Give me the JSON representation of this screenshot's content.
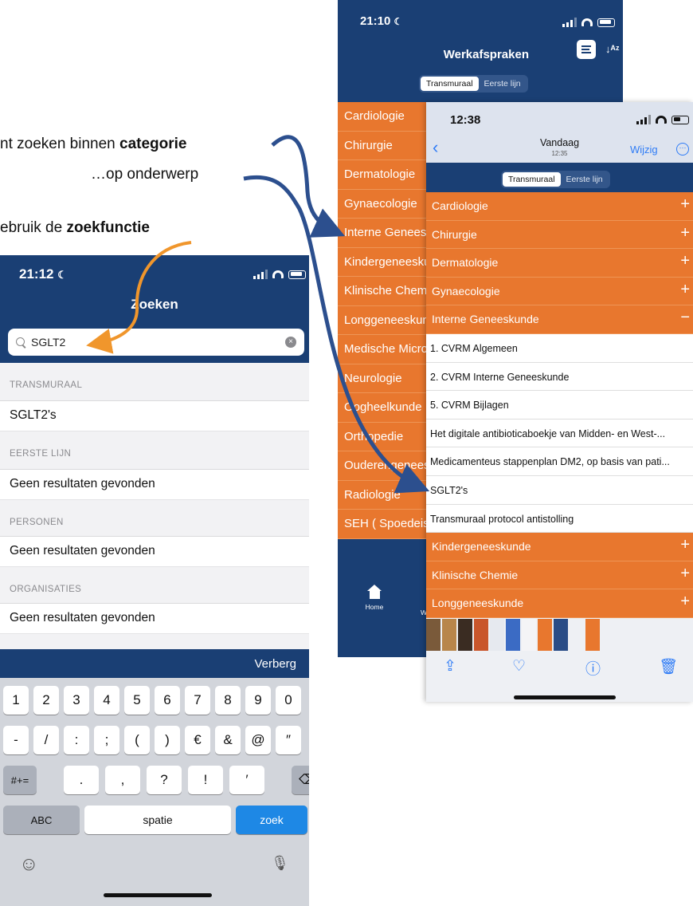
{
  "annotations": {
    "line1_prefix": "nt zoeken binnen ",
    "line1_bold": "categorie",
    "line2": "…op onderwerp",
    "line3_prefix": "ebruik de ",
    "line3_bold": "zoekfunctie"
  },
  "search_phone": {
    "time": "21:12",
    "title": "Zoeken",
    "search_value": "SGLT2",
    "clear_glyph": "×",
    "sections": [
      {
        "header": "TRANSMURAAL",
        "row": "SGLT2's"
      },
      {
        "header": "EERSTE LIJN",
        "row": "Geen resultaten gevonden"
      },
      {
        "header": "PERSONEN",
        "row": "Geen resultaten gevonden"
      },
      {
        "header": "ORGANISATIES",
        "row": "Geen resultaten gevonden"
      }
    ],
    "keyboard": {
      "hide_label": "Verberg",
      "row1": [
        "1",
        "2",
        "3",
        "4",
        "5",
        "6",
        "7",
        "8",
        "9",
        "0"
      ],
      "row2": [
        "-",
        "/",
        ":",
        ";",
        "(",
        ")",
        "€",
        "&",
        "@",
        "″"
      ],
      "row3_switch": "#+=",
      "row3": [
        ".",
        ",",
        "?",
        "!",
        "′"
      ],
      "row3_delete": "⌫",
      "abc": "ABC",
      "space": "spatie",
      "submit": "zoek",
      "emoji": "☺",
      "mic": "🎙"
    }
  },
  "werkafspraken_phone": {
    "time": "21:10",
    "title": "Werkafspraken",
    "sort_glyph": "↓ᴬᶻ",
    "segments": [
      "Transmuraal",
      "Eerste lijn"
    ],
    "categories": [
      "Cardiologie",
      "Chirurgie",
      "Dermatologie",
      "Gynaecologie",
      "Interne Geneeskunde",
      "Kindergeneeskunde",
      "Klinische Chemie",
      "Longgeneeskunde",
      "Medische Microbiologie",
      "Neurologie",
      "Oogheelkunde",
      "Orthopedie",
      "Ouderengeneeskunde",
      "Radiologie",
      "SEH ( Spoedeisende Hulp)"
    ],
    "tab_home": "Home",
    "tab_second": "W"
  },
  "photo_phone": {
    "time": "12:38",
    "title": "Vandaag",
    "subtitle": "12:35",
    "edit": "Wijzig",
    "more_glyph": "⋯",
    "back_glyph": "‹",
    "segments": [
      "Transmuraal",
      "Eerste lijn"
    ],
    "categories_top": [
      {
        "label": "Cardiologie",
        "sign": "+"
      },
      {
        "label": "Chirurgie",
        "sign": "+"
      },
      {
        "label": "Dermatologie",
        "sign": "+"
      },
      {
        "label": "Gynaecologie",
        "sign": "+"
      },
      {
        "label": "Interne Geneeskunde",
        "sign": "−"
      }
    ],
    "subjects": [
      "1. CVRM Algemeen",
      "2. CVRM Interne Geneeskunde",
      "5. CVRM Bijlagen",
      "Het digitale antibioticaboekje van Midden- en West-...",
      "Medicamenteus stappenplan DM2, op basis van pati...",
      "SGLT2's",
      "Transmuraal protocol antistolling"
    ],
    "categories_bottom": [
      {
        "label": "Kindergeneeskunde",
        "sign": "+"
      },
      {
        "label": "Klinische Chemie",
        "sign": "+"
      },
      {
        "label": "Longgeneeskunde",
        "sign": "+"
      }
    ],
    "toolbar": {
      "share": "⇪",
      "like": "♡",
      "info": "ⓘ",
      "delete": "🗑"
    }
  },
  "colors": {
    "navy": "#1a3f74",
    "orange": "#e8772e",
    "arrow_blue": "#2c4f8e",
    "arrow_orange": "#f0962c",
    "ios_blue": "#2f7cf6"
  }
}
